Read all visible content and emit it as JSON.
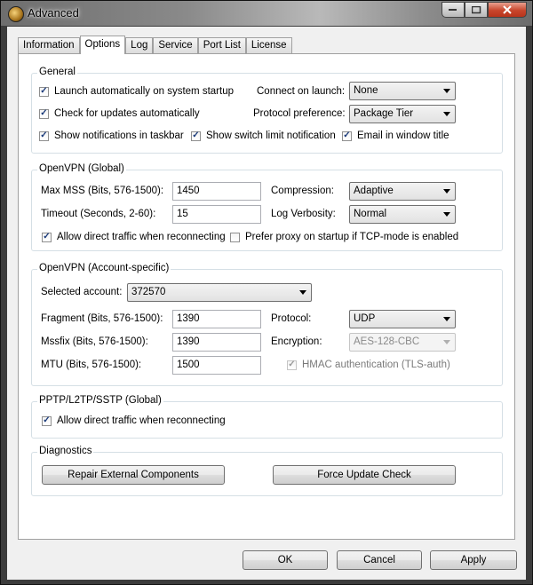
{
  "window": {
    "title": "Advanced"
  },
  "tabs": [
    {
      "label": "Information"
    },
    {
      "label": "Options"
    },
    {
      "label": "Log"
    },
    {
      "label": "Service"
    },
    {
      "label": "Port List"
    },
    {
      "label": "License"
    }
  ],
  "active_tab": "Options",
  "general": {
    "title": "General",
    "launch_auto": {
      "label": "Launch automatically on system startup",
      "checked": true
    },
    "check_updates": {
      "label": "Check for updates automatically",
      "checked": true
    },
    "show_notifications": {
      "label": "Show notifications in taskbar",
      "checked": true
    },
    "show_switch_limit": {
      "label": "Show switch limit notification",
      "checked": true
    },
    "email_in_title": {
      "label": "Email in window title",
      "checked": true
    },
    "connect_on_launch": {
      "label": "Connect on launch:",
      "value": "None"
    },
    "protocol_pref": {
      "label": "Protocol preference:",
      "value": "Package Tier"
    }
  },
  "openvpn_global": {
    "title": "OpenVPN (Global)",
    "max_mss": {
      "label": "Max MSS (Bits, 576-1500):",
      "value": "1450"
    },
    "timeout": {
      "label": "Timeout (Seconds, 2-60):",
      "value": "15"
    },
    "compression": {
      "label": "Compression:",
      "value": "Adaptive"
    },
    "log_verbosity": {
      "label": "Log Verbosity:",
      "value": "Normal"
    },
    "allow_direct": {
      "label": "Allow direct traffic when reconnecting",
      "checked": true
    },
    "prefer_proxy": {
      "label": "Prefer proxy on startup if TCP-mode is enabled",
      "checked": false
    }
  },
  "openvpn_account": {
    "title": "OpenVPN (Account-specific)",
    "selected_account": {
      "label": "Selected account:",
      "value": "372570"
    },
    "fragment": {
      "label": "Fragment (Bits, 576-1500):",
      "value": "1390"
    },
    "mssfix": {
      "label": "Mssfix (Bits, 576-1500):",
      "value": "1390"
    },
    "mtu": {
      "label": "MTU (Bits, 576-1500):",
      "value": "1500"
    },
    "protocol": {
      "label": "Protocol:",
      "value": "UDP"
    },
    "encryption": {
      "label": "Encryption:",
      "value": "AES-128-CBC"
    },
    "hmac": {
      "label": "HMAC authentication (TLS-auth)",
      "checked": true
    }
  },
  "pptp": {
    "title": "PPTP/L2TP/SSTP (Global)",
    "allow_direct": {
      "label": "Allow direct traffic when reconnecting",
      "checked": true
    }
  },
  "diagnostics": {
    "title": "Diagnostics",
    "repair": "Repair External Components",
    "force_update": "Force Update Check"
  },
  "footer": {
    "ok": "OK",
    "cancel": "Cancel",
    "apply": "Apply"
  }
}
